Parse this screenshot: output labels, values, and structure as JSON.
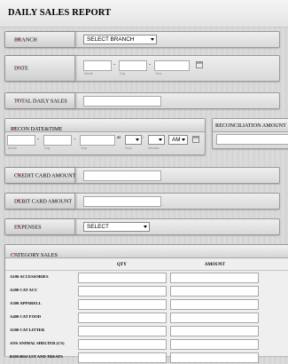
{
  "title": "DAILY SALES REPORT",
  "branch": {
    "label": "BRANCH",
    "required": "*",
    "select_value": "SELECT BRANCH"
  },
  "date": {
    "label": "DATE",
    "required": "*",
    "sub_month": "Month",
    "sub_day": "Day",
    "sub_year": "Year",
    "sep": "-"
  },
  "total_daily_sales": {
    "label": "TOTAL DAILY SALES",
    "required": "*"
  },
  "recon": {
    "label": "RECON DATE&TIME",
    "required": "*",
    "sub_month": "Month",
    "sub_day": "Day",
    "sub_year": "Year",
    "at": "at",
    "sub_hour": "Hour",
    "sub_minutes": "Minutes",
    "ampm": "AM",
    "sep": "-",
    "colon": ":"
  },
  "reconciliation_amount": {
    "label": "RECONCILIATION AMOUNT"
  },
  "credit_card_amount": {
    "label": "CREDIT CARD AMOUNT",
    "required": "*"
  },
  "debit_card_amount": {
    "label": "DEBIT CARD AMOUNT",
    "required": "*"
  },
  "expenses": {
    "label": "EXPENSES",
    "required": "*",
    "select_value": "SELECT"
  },
  "category_sales": {
    "label": "CATEGORY SALES",
    "required": "*",
    "columns": [
      "QTY",
      "AMOUNT"
    ],
    "rows": [
      "A100 ACCESSORIES",
      "A200 CAT ACC",
      "A300 APPARELL",
      "A400 CAT FOOD",
      "A500 CAT LITTER",
      "ANS ANIMAL SHELTER (CS)",
      "B100 BISCUIT AND TREATS"
    ]
  }
}
